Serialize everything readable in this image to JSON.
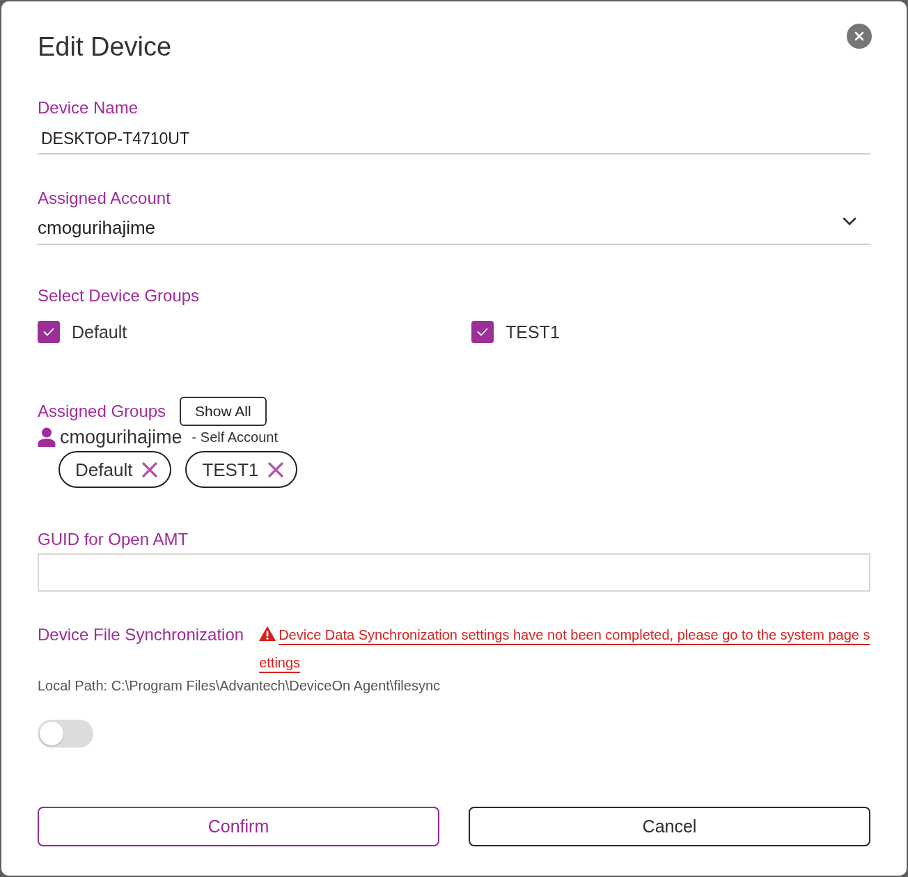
{
  "dialog": {
    "title": "Edit Device"
  },
  "device_name": {
    "label": "Device Name",
    "value": "DESKTOP-T4710UT"
  },
  "assigned_account": {
    "label": "Assigned Account",
    "value": "cmogurihajime"
  },
  "device_groups": {
    "label": "Select Device Groups",
    "options": [
      {
        "label": "Default",
        "checked": true
      },
      {
        "label": "TEST1",
        "checked": true
      }
    ]
  },
  "assigned_groups": {
    "label": "Assigned Groups",
    "show_all_button": "Show All",
    "accounts": [
      {
        "name": "cmogurihajime",
        "note": "- Self Account",
        "groups": [
          "Default",
          "TEST1"
        ]
      }
    ]
  },
  "guid": {
    "label": "GUID for Open AMT"
  },
  "file_sync": {
    "label": "Device File Synchronization",
    "warning": "Device Data Synchronization settings have not been completed, please go to the system page settings",
    "local_path": "Local Path: C:\\Program Files\\Advantech\\DeviceOn Agent\\filesync",
    "on": false
  },
  "buttons": [
    {
      "label": "Confirm",
      "kind": "primary"
    },
    {
      "label": "Cancel",
      "kind": "secondary"
    }
  ]
}
